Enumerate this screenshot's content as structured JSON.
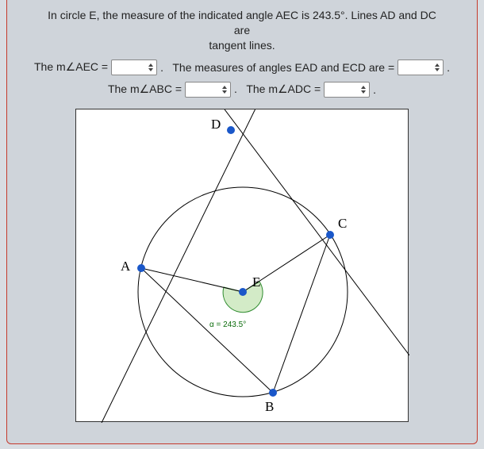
{
  "problem": {
    "line1": "In circle E, the measure of the indicated angle AEC is 243.5°. Lines AD and DC are",
    "line2": "tangent lines."
  },
  "prompts": {
    "aec_prefix": "The m∠AEC =",
    "ead_ecd_prefix": ".   The measures of angles EAD and ECD are =",
    "abc_prefix": "The m∠ABC =",
    "adc_prefix": ".   The m∠ADC =",
    "period": "."
  },
  "inputs": {
    "aec": "",
    "ead_ecd": "",
    "abc": "",
    "adc": ""
  },
  "diagram": {
    "points": {
      "A": "A",
      "B": "B",
      "C": "C",
      "D": "D",
      "E": "E"
    },
    "angle_value": "α = 243.5°"
  }
}
